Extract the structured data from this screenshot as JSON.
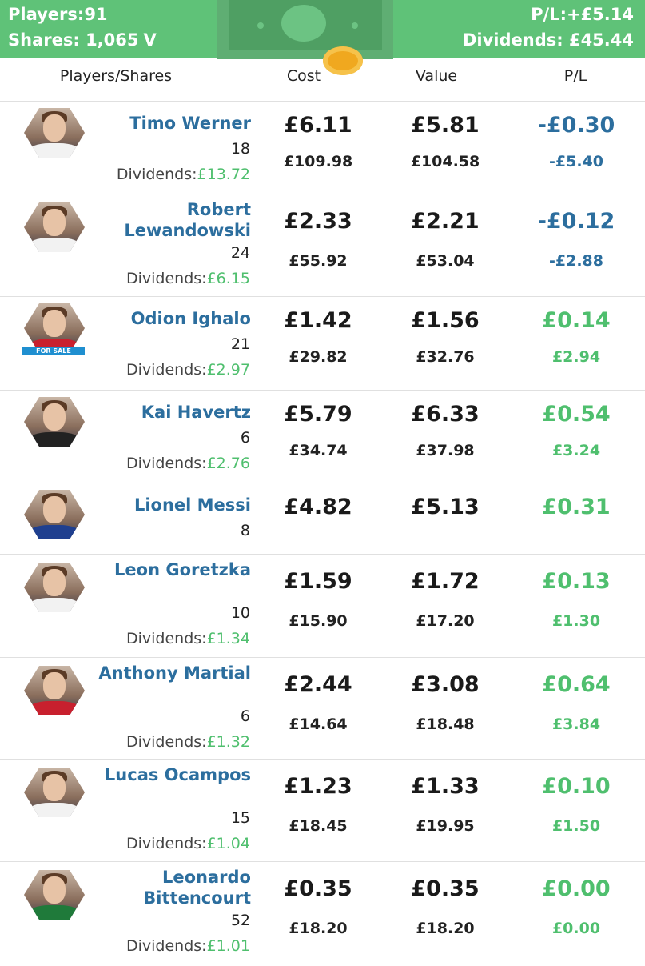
{
  "summary": {
    "players_label": "Players:",
    "players_value": "91",
    "shares_label": "Shares:",
    "shares_value": "1,065",
    "shares_cutoff": "V",
    "pl_label": "P/L:",
    "pl_value": "+£5.14",
    "dividends_label": "Dividends:",
    "dividends_value": "£45.44"
  },
  "columns": {
    "players": "Players/Shares",
    "cost": "Cost",
    "value": "Value",
    "pl": "P/L"
  },
  "dividends_label": "Dividends:",
  "rows": [
    {
      "name": "Timo Werner",
      "shares": "18",
      "dividends": "£13.72",
      "cost": "£6.11",
      "cost_total": "£109.98",
      "value": "£5.81",
      "value_total": "£104.58",
      "pl": "-£0.30",
      "pl_total": "-£5.40",
      "pl_sign": "neg",
      "shirt_color": "#f2f2f2"
    },
    {
      "name": "Robert Lewandowski",
      "shares": "24",
      "dividends": "£6.15",
      "cost": "£2.33",
      "cost_total": "£55.92",
      "value": "£2.21",
      "value_total": "£53.04",
      "pl": "-£0.12",
      "pl_total": "-£2.88",
      "pl_sign": "neg",
      "shirt_color": "#f2f2f2"
    },
    {
      "name": "Odion Ighalo",
      "shares": "21",
      "dividends": "£2.97",
      "cost": "£1.42",
      "cost_total": "£29.82",
      "value": "£1.56",
      "value_total": "£32.76",
      "pl": "£0.14",
      "pl_total": "£2.94",
      "pl_sign": "pos",
      "shirt_color": "#c8202e",
      "badge": "FOR SALE"
    },
    {
      "name": "Kai Havertz",
      "shares": "6",
      "dividends": "£2.76",
      "cost": "£5.79",
      "cost_total": "£34.74",
      "value": "£6.33",
      "value_total": "£37.98",
      "pl": "£0.54",
      "pl_total": "£3.24",
      "pl_sign": "pos",
      "shirt_color": "#222222"
    },
    {
      "name": "Lionel Messi",
      "shares": "8",
      "dividends": "",
      "cost": "£4.82",
      "cost_total": "",
      "value": "£5.13",
      "value_total": "",
      "pl": "£0.31",
      "pl_total": "",
      "pl_sign": "pos",
      "shirt_color": "#1f3f8f"
    },
    {
      "name": "Leon Goretzka",
      "shares": "10",
      "dividends": "£1.34",
      "cost": "£1.59",
      "cost_total": "£15.90",
      "value": "£1.72",
      "value_total": "£17.20",
      "pl": "£0.13",
      "pl_total": "£1.30",
      "pl_sign": "pos",
      "shirt_color": "#f2f2f2"
    },
    {
      "name": "Anthony Martial",
      "shares": "6",
      "dividends": "£1.32",
      "cost": "£2.44",
      "cost_total": "£14.64",
      "value": "£3.08",
      "value_total": "£18.48",
      "pl": "£0.64",
      "pl_total": "£3.84",
      "pl_sign": "pos",
      "shirt_color": "#c8202e"
    },
    {
      "name": "Lucas Ocampos",
      "shares": "15",
      "dividends": "£1.04",
      "cost": "£1.23",
      "cost_total": "£18.45",
      "value": "£1.33",
      "value_total": "£19.95",
      "pl": "£0.10",
      "pl_total": "£1.50",
      "pl_sign": "pos",
      "shirt_color": "#f2f2f2"
    },
    {
      "name": "Leonardo Bittencourt",
      "shares": "52",
      "dividends": "£1.01",
      "cost": "£0.35",
      "cost_total": "£18.20",
      "value": "£0.35",
      "value_total": "£18.20",
      "pl": "£0.00",
      "pl_total": "£0.00",
      "pl_sign": "pos",
      "shirt_color": "#1f7a3a"
    }
  ]
}
